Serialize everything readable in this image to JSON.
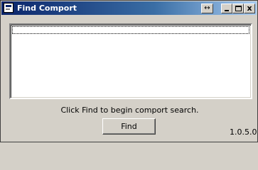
{
  "window": {
    "title": "Find Comport",
    "title_icon": "app-window-icon",
    "controls": {
      "resize_glyph": "↔",
      "close_glyph": "x"
    }
  },
  "listbox": {
    "items": []
  },
  "status_text": "Click Find to begin comport search.",
  "find_button_label": "Find",
  "version": "1.0.5.0",
  "colors": {
    "titlebar_start": "#0a246a",
    "titlebar_end": "#a6caf0",
    "face": "#d4d0c8",
    "list_bg": "#ffffff"
  }
}
